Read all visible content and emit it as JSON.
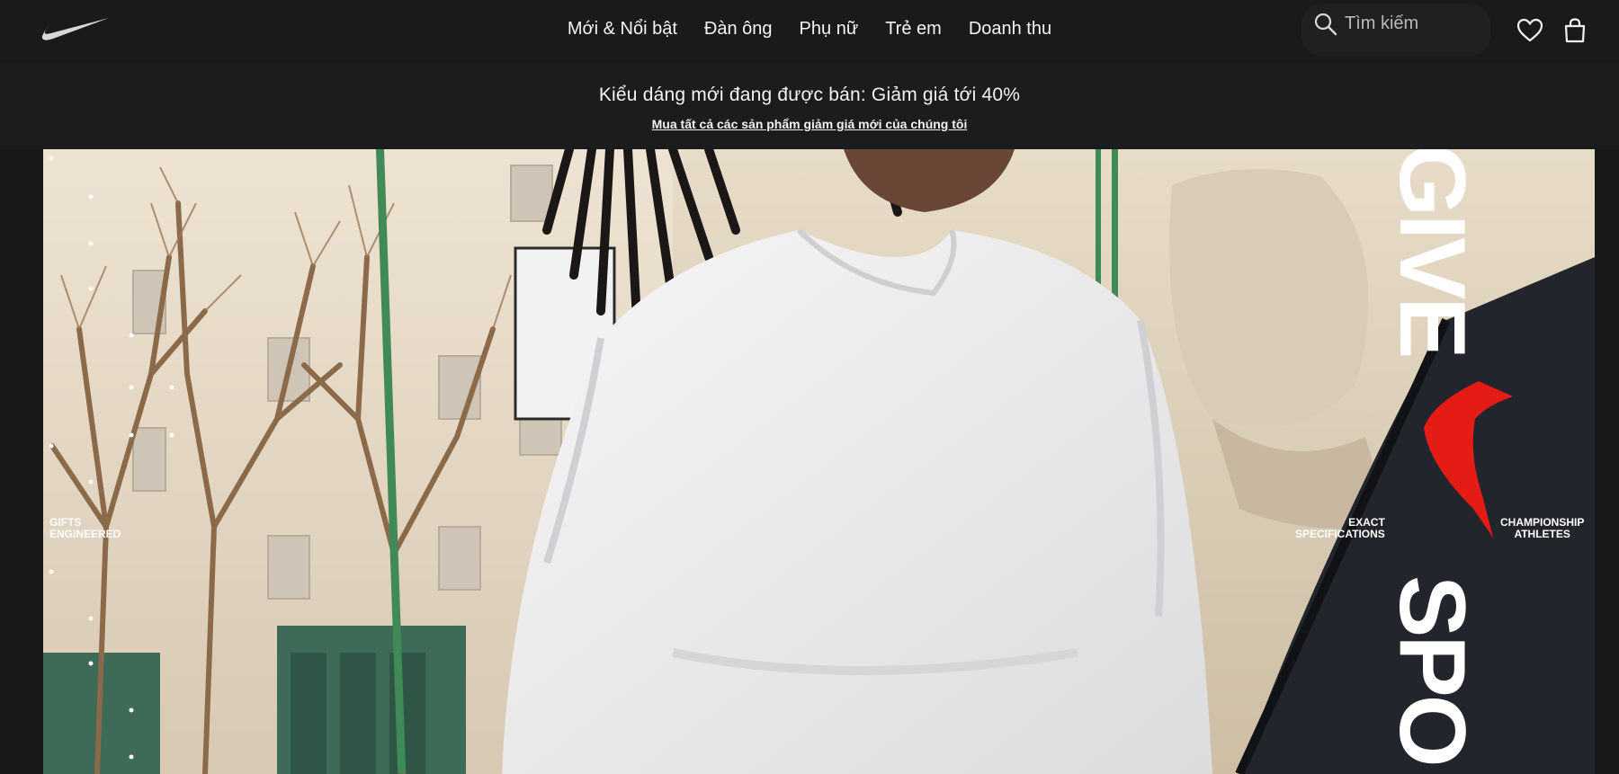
{
  "header": {
    "logo": "nike-swoosh-logo",
    "nav": [
      {
        "label": "Mới & Nổi bật"
      },
      {
        "label": "Đàn ông"
      },
      {
        "label": "Phụ nữ"
      },
      {
        "label": "Trẻ em"
      },
      {
        "label": "Doanh thu"
      }
    ],
    "search": {
      "placeholder": "Tìm kiếm",
      "icon": "search-icon"
    },
    "favorites_icon": "heart-icon",
    "bag_icon": "shopping-bag-icon"
  },
  "promo": {
    "title": "Kiểu dáng mới đang được bán: Giảm giá tới 40%",
    "link": "Mua tất cả các sản phẩm giảm giá mới của chúng tôi"
  },
  "hero": {
    "caption_left": "GIFTS\nENGINEERED",
    "caption_mid": "EXACT\nSPECIFICATIONS",
    "caption_right": "CHAMPIONSHIP\nATHLETES",
    "word_top": "GIVE",
    "word_bottom": "SPO",
    "accent_color": "#e51b16",
    "background_color": "#18191b"
  }
}
